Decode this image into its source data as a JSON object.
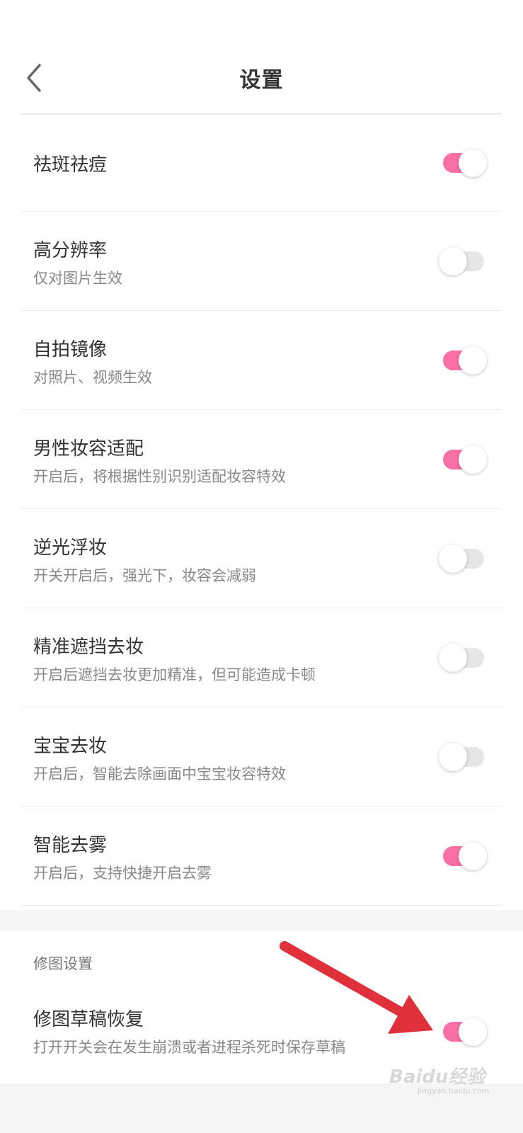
{
  "header": {
    "title": "设置",
    "back_icon": "chevron-left-icon"
  },
  "colors": {
    "switch_on": "#fb6fa7",
    "switch_off": "#e6e6e6",
    "arrow": "#e0303a"
  },
  "settings": [
    {
      "label": "祛斑祛痘",
      "sub": "",
      "on": true
    },
    {
      "label": "高分辨率",
      "sub": "仅对图片生效",
      "on": false
    },
    {
      "label": "自拍镜像",
      "sub": "对照片、视频生效",
      "on": true
    },
    {
      "label": "男性妆容适配",
      "sub": "开启后，将根据性别识别适配妆容特效",
      "on": true
    },
    {
      "label": "逆光浮妆",
      "sub": "开关开启后，强光下，妆容会减弱",
      "on": false
    },
    {
      "label": "精准遮挡去妆",
      "sub": "开启后遮挡去妆更加精准，但可能造成卡顿",
      "on": false
    },
    {
      "label": "宝宝去妆",
      "sub": "开启后，智能去除画面中宝宝妆容特效",
      "on": false
    },
    {
      "label": "智能去雾",
      "sub": "开启后，支持快捷开启去雾",
      "on": true
    }
  ],
  "retouch_section": {
    "title": "修图设置",
    "item": {
      "label": "修图草稿恢复",
      "sub": "打开开关会在发生崩溃或者进程杀死时保存草稿",
      "on": true
    }
  },
  "watermark": {
    "brand": "Baidu经验",
    "url": "jingyan.baidu.com"
  }
}
